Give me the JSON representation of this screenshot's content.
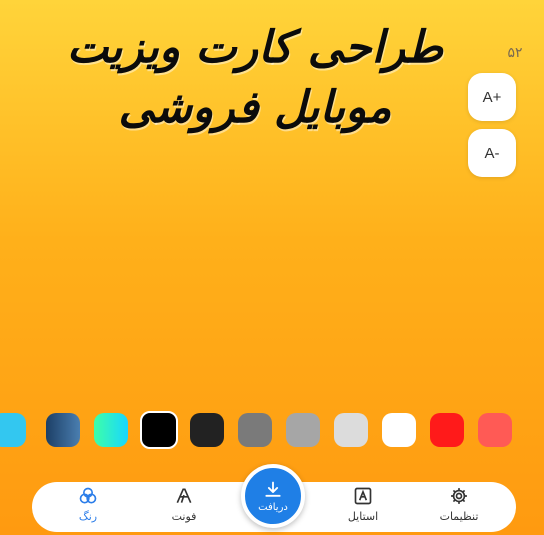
{
  "canvas": {
    "headline": "طراحی کارت ویزیت موبایل فروشی",
    "font_size_value": "۵۲"
  },
  "size_controls": {
    "increase_label": "A+",
    "decrease_label": "A-"
  },
  "palette": {
    "swatches": [
      "#ff5a55",
      "#ff1a1a",
      "#ffffff",
      "#dcdcdc",
      "#a6a6a6",
      "#7a7a7a",
      "#222222",
      "#000000",
      "#3dffa8",
      "#2f6aa0",
      "#33c7f0"
    ],
    "selected": "#000000"
  },
  "nav": {
    "settings_label": "تنظیمات",
    "style_label": "استایل",
    "download_label": "دریافت",
    "font_label": "فونت",
    "color_label": "رنگ",
    "active": "color"
  },
  "colors": {
    "accent": "#1f7fe6",
    "background_top": "#ffd43a",
    "background_bottom": "#ff9a10"
  }
}
